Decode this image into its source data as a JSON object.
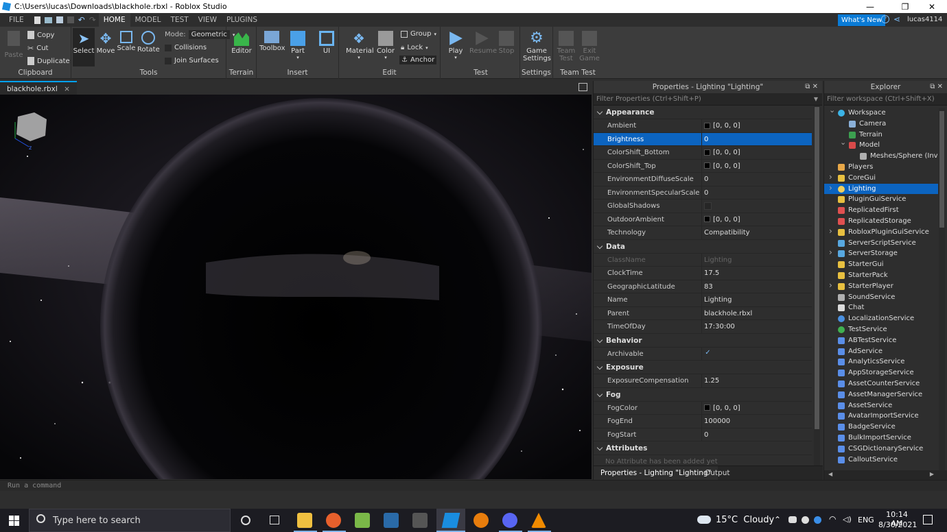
{
  "window": {
    "title": "C:\\Users\\lucas\\Downloads\\blackhole.rbxl - Roblox Studio",
    "minimize": "—",
    "restore": "❐",
    "close": "✕"
  },
  "menu": {
    "tabs": [
      "FILE",
      "HOME",
      "MODEL",
      "TEST",
      "VIEW",
      "PLUGINS"
    ],
    "active": "HOME",
    "whats_new": "What's New",
    "username": "lucas4114"
  },
  "ribbon": {
    "clipboard": {
      "paste": "Paste",
      "copy": "Copy",
      "cut": "Cut",
      "duplicate": "Duplicate",
      "label": "Clipboard"
    },
    "tools": {
      "select": "Select",
      "move": "Move",
      "scale": "Scale",
      "rotate": "Rotate",
      "mode_label": "Mode:",
      "mode_value": "Geometric",
      "collisions": "Collisions",
      "join_surfaces": "Join Surfaces",
      "label": "Tools"
    },
    "terrain": {
      "editor": "Editor",
      "label": "Terrain"
    },
    "insert": {
      "toolbox": "Toolbox",
      "part": "Part",
      "ui": "UI",
      "label": "Insert"
    },
    "edit": {
      "material": "Material",
      "color": "Color",
      "group": "Group",
      "lock": "Lock",
      "anchor": "Anchor",
      "label": "Edit"
    },
    "test": {
      "play": "Play",
      "resume": "Resume",
      "stop": "Stop",
      "label": "Test"
    },
    "settings": {
      "game_settings_1": "Game",
      "game_settings_2": "Settings",
      "label": "Settings"
    },
    "team_test": {
      "team_test_1": "Team",
      "team_test_2": "Test",
      "exit_game_1": "Exit",
      "exit_game_2": "Game",
      "label": "Team Test"
    }
  },
  "document": {
    "tab": "blackhole.rbxl",
    "close": "×"
  },
  "properties": {
    "header": "Properties - Lighting \"Lighting\"",
    "filter_placeholder": "Filter Properties (Ctrl+Shift+P)",
    "categories": [
      {
        "name": "Appearance",
        "rows": [
          {
            "name": "Ambient",
            "value": "[0, 0, 0]",
            "swatch": true
          },
          {
            "name": "Brightness",
            "value": "0",
            "selected": true
          },
          {
            "name": "ColorShift_Bottom",
            "value": "[0, 0, 0]",
            "swatch": true
          },
          {
            "name": "ColorShift_Top",
            "value": "[0, 0, 0]",
            "swatch": true
          },
          {
            "name": "EnvironmentDiffuseScale",
            "value": "0"
          },
          {
            "name": "EnvironmentSpecularScale",
            "value": "0"
          },
          {
            "name": "GlobalShadows",
            "value": "",
            "checkbox": true,
            "checked": false
          },
          {
            "name": "OutdoorAmbient",
            "value": "[0, 0, 0]",
            "swatch": true
          },
          {
            "name": "Technology",
            "value": "Compatibility"
          }
        ]
      },
      {
        "name": "Data",
        "rows": [
          {
            "name": "ClassName",
            "value": "Lighting",
            "dim": true
          },
          {
            "name": "ClockTime",
            "value": "17.5"
          },
          {
            "name": "GeographicLatitude",
            "value": "83"
          },
          {
            "name": "Name",
            "value": "Lighting"
          },
          {
            "name": "Parent",
            "value": "blackhole.rbxl"
          },
          {
            "name": "TimeOfDay",
            "value": "17:30:00"
          }
        ]
      },
      {
        "name": "Behavior",
        "rows": [
          {
            "name": "Archivable",
            "value": "",
            "checkbox": true,
            "checked": true
          }
        ]
      },
      {
        "name": "Exposure",
        "rows": [
          {
            "name": "ExposureCompensation",
            "value": "1.25"
          }
        ]
      },
      {
        "name": "Fog",
        "rows": [
          {
            "name": "FogColor",
            "value": "[0, 0, 0]",
            "swatch": true
          },
          {
            "name": "FogEnd",
            "value": "100000"
          },
          {
            "name": "FogStart",
            "value": "0"
          }
        ]
      },
      {
        "name": "Attributes",
        "rows": [
          {
            "name": "No Attribute has been added yet",
            "value": "",
            "dim": true,
            "note": true
          }
        ]
      }
    ],
    "bottom_tabs": [
      "Properties - Lighting \"Lighting\"",
      "Output"
    ]
  },
  "explorer": {
    "header": "Explorer",
    "filter_placeholder": "Filter workspace (Ctrl+Shift+X)",
    "items": [
      {
        "label": "Workspace",
        "depth": 0,
        "arrow": "open",
        "color": "#3cb4e6",
        "round": true
      },
      {
        "label": "Camera",
        "depth": 1,
        "arrow": "",
        "color": "#8ab0d8"
      },
      {
        "label": "Terrain",
        "depth": 1,
        "arrow": "",
        "color": "#3ca050"
      },
      {
        "label": "Model",
        "depth": 1,
        "arrow": "open",
        "color": "#d84a4a"
      },
      {
        "label": "Meshes/Sphere (Invert",
        "depth": 2,
        "arrow": "",
        "color": "#b0b0b0"
      },
      {
        "label": "Players",
        "depth": 0,
        "arrow": "",
        "color": "#e8a848"
      },
      {
        "label": "CoreGui",
        "depth": 0,
        "arrow": "closed",
        "color": "#e8c040"
      },
      {
        "label": "Lighting",
        "depth": 0,
        "arrow": "closed",
        "color": "#f0d060",
        "selected": true,
        "round": true
      },
      {
        "label": "PluginGuiService",
        "depth": 0,
        "arrow": "",
        "color": "#e8c040"
      },
      {
        "label": "ReplicatedFirst",
        "depth": 0,
        "arrow": "",
        "color": "#e05050"
      },
      {
        "label": "ReplicatedStorage",
        "depth": 0,
        "arrow": "",
        "color": "#e05050"
      },
      {
        "label": "RobloxPluginGuiService",
        "depth": 0,
        "arrow": "closed",
        "color": "#e8c040"
      },
      {
        "label": "ServerScriptService",
        "depth": 0,
        "arrow": "",
        "color": "#58a8e0"
      },
      {
        "label": "ServerStorage",
        "depth": 0,
        "arrow": "closed",
        "color": "#58a8e0"
      },
      {
        "label": "StarterGui",
        "depth": 0,
        "arrow": "",
        "color": "#e8c040"
      },
      {
        "label": "StarterPack",
        "depth": 0,
        "arrow": "",
        "color": "#e8c040"
      },
      {
        "label": "StarterPlayer",
        "depth": 0,
        "arrow": "closed",
        "color": "#e8c040"
      },
      {
        "label": "SoundService",
        "depth": 0,
        "arrow": "",
        "color": "#b0b0b0"
      },
      {
        "label": "Chat",
        "depth": 0,
        "arrow": "",
        "color": "#dcdcdc"
      },
      {
        "label": "LocalizationService",
        "depth": 0,
        "arrow": "",
        "color": "#4a90e0",
        "round": true
      },
      {
        "label": "TestService",
        "depth": 0,
        "arrow": "",
        "color": "#40b050",
        "round": true
      },
      {
        "label": "ABTestService",
        "depth": 0,
        "arrow": "",
        "color": "#5a8ee8"
      },
      {
        "label": "AdService",
        "depth": 0,
        "arrow": "",
        "color": "#5a8ee8"
      },
      {
        "label": "AnalyticsService",
        "depth": 0,
        "arrow": "",
        "color": "#5a8ee8"
      },
      {
        "label": "AppStorageService",
        "depth": 0,
        "arrow": "",
        "color": "#5a8ee8"
      },
      {
        "label": "AssetCounterService",
        "depth": 0,
        "arrow": "",
        "color": "#5a8ee8"
      },
      {
        "label": "AssetManagerService",
        "depth": 0,
        "arrow": "",
        "color": "#5a8ee8"
      },
      {
        "label": "AssetService",
        "depth": 0,
        "arrow": "",
        "color": "#5a8ee8"
      },
      {
        "label": "AvatarImportService",
        "depth": 0,
        "arrow": "",
        "color": "#5a8ee8"
      },
      {
        "label": "BadgeService",
        "depth": 0,
        "arrow": "",
        "color": "#5a8ee8"
      },
      {
        "label": "BulkImportService",
        "depth": 0,
        "arrow": "",
        "color": "#5a8ee8"
      },
      {
        "label": "CSGDictionaryService",
        "depth": 0,
        "arrow": "",
        "color": "#5a8ee8"
      },
      {
        "label": "CalloutService",
        "depth": 0,
        "arrow": "",
        "color": "#5a8ee8"
      }
    ]
  },
  "command_bar": {
    "placeholder": "Run a command"
  },
  "taskbar": {
    "search_placeholder": "Type here to search",
    "weather": "15°C  Cloudy",
    "lang": "ENG",
    "time": "10:14 AM",
    "date": "8/30/2021"
  },
  "colors": {
    "accent": "#0c64c0",
    "whats_new": "#0a7bd6",
    "tab_highlight": "#00a2ff"
  }
}
